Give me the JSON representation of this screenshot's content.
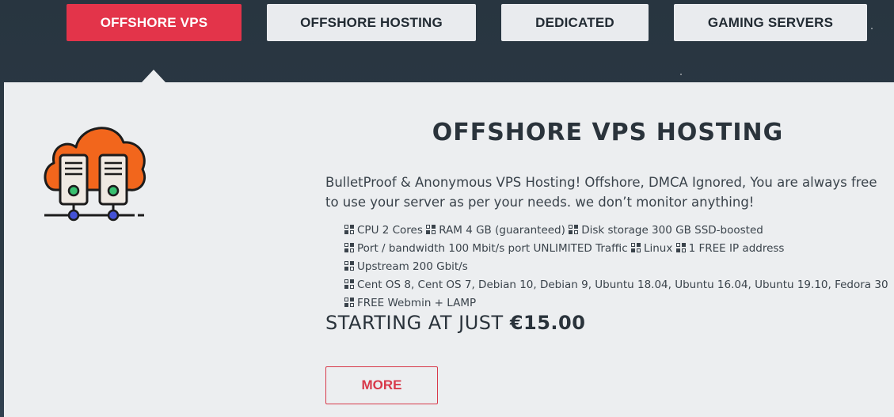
{
  "tabs": [
    {
      "label": "OFFSHORE VPS",
      "active": true
    },
    {
      "label": "OFFSHORE HOSTING",
      "active": false
    },
    {
      "label": "DEDICATED",
      "active": false
    },
    {
      "label": "GAMING SERVERS",
      "active": false
    }
  ],
  "product": {
    "icon": "cloud-servers-icon",
    "title_regular_1": "OFFSHORE ",
    "title_bold": "VPS",
    "title_regular_2": " HOSTING",
    "description": "BulletProof & Anonymous VPS Hosting! Offshore, DMCA Ignored, You are always free to use your server as per your needs. we don’t monitor anything!",
    "features": [
      [
        "CPU 2 Cores",
        "RAM 4 GB (guaranteed)",
        "Disk storage 300 GB SSD-boosted"
      ],
      [
        "Port / bandwidth 100 Mbit/s port UNLIMITED Traffic",
        "Linux",
        "1 FREE IP address"
      ],
      [
        "Upstream 200 Gbit/s"
      ],
      [
        "Cent OS 8, Cent OS 7, Debian 10, Debian 9, Ubuntu 18.04, Ubuntu 16.04, Ubuntu 19.10, Fedora 30"
      ],
      [
        "FREE Webmin + LAMP"
      ]
    ],
    "price_prefix": "STARTING AT JUST ",
    "price": "€15.00",
    "more_label": "MORE"
  },
  "colors": {
    "accent": "#e3344a",
    "background": "#2c3a45",
    "panel": "#eceef0",
    "cloud": "#f2661c"
  }
}
